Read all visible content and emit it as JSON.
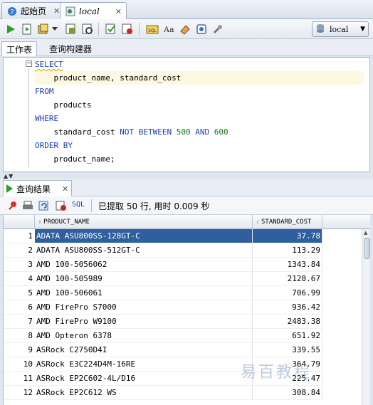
{
  "doc_tabs": [
    {
      "label": "起始页",
      "icon": "help-icon"
    },
    {
      "label": "local",
      "icon": "sql-worksheet-icon"
    }
  ],
  "toolbar": {
    "connection": "local",
    "buttons": [
      "run-statement-icon",
      "run-script-icon",
      "commit-icon",
      "dropdown-arrow",
      "explain-plan-icon",
      "autotrace-icon",
      "sql-tuning-icon",
      "clear-icon",
      "sql-history-icon",
      "format-case-icon",
      "eraser-icon",
      "unshared-icon",
      "tools-icon"
    ]
  },
  "worksheet_tabs": [
    "工作表",
    "查询构建器"
  ],
  "editor": {
    "lines": [
      {
        "kw": "SELECT",
        "rest": ""
      },
      {
        "indent": "    ",
        "text": "product_name, standard_cost"
      },
      {
        "kw": "FROM",
        "rest": ""
      },
      {
        "indent": "    ",
        "text": "products"
      },
      {
        "kw": "WHERE",
        "rest": ""
      },
      {
        "indent": "    ",
        "text": "standard_cost ",
        "kw2": "NOT BETWEEN",
        "n1": "500",
        "kw3": "AND",
        "n2": "600"
      },
      {
        "kw": "ORDER BY",
        "rest": ""
      },
      {
        "indent": "    ",
        "text": "product_name;"
      }
    ]
  },
  "results": {
    "tab_label": "查询结果",
    "sql_label": "SQL",
    "status": "已提取 50 行, 用时 0.009 秒",
    "columns": [
      "PRODUCT_NAME",
      "STANDARD_COST"
    ],
    "rows": [
      {
        "n": "1",
        "name": "ADATA ASU800SS-128GT-C",
        "cost": "37.78"
      },
      {
        "n": "2",
        "name": "ADATA ASU800SS-512GT-C",
        "cost": "113.29"
      },
      {
        "n": "3",
        "name": "AMD 100-5056062",
        "cost": "1343.84"
      },
      {
        "n": "4",
        "name": "AMD 100-505989",
        "cost": "2128.67"
      },
      {
        "n": "5",
        "name": "AMD 100-506061",
        "cost": "706.99"
      },
      {
        "n": "6",
        "name": "AMD FirePro S7000",
        "cost": "936.42"
      },
      {
        "n": "7",
        "name": "AMD FirePro W9100",
        "cost": "2483.38"
      },
      {
        "n": "8",
        "name": "AMD Opteron 6378",
        "cost": "651.92"
      },
      {
        "n": "9",
        "name": "ASRock C2750D4I",
        "cost": "339.55"
      },
      {
        "n": "10",
        "name": "ASRock E3C224D4M-16RE",
        "cost": "364.79"
      },
      {
        "n": "11",
        "name": "ASRock EP2C602-4L/D16",
        "cost": "225.47"
      },
      {
        "n": "12",
        "name": "ASRock EP2C612 WS",
        "cost": "308.84"
      }
    ]
  },
  "watermark": "易百教程"
}
